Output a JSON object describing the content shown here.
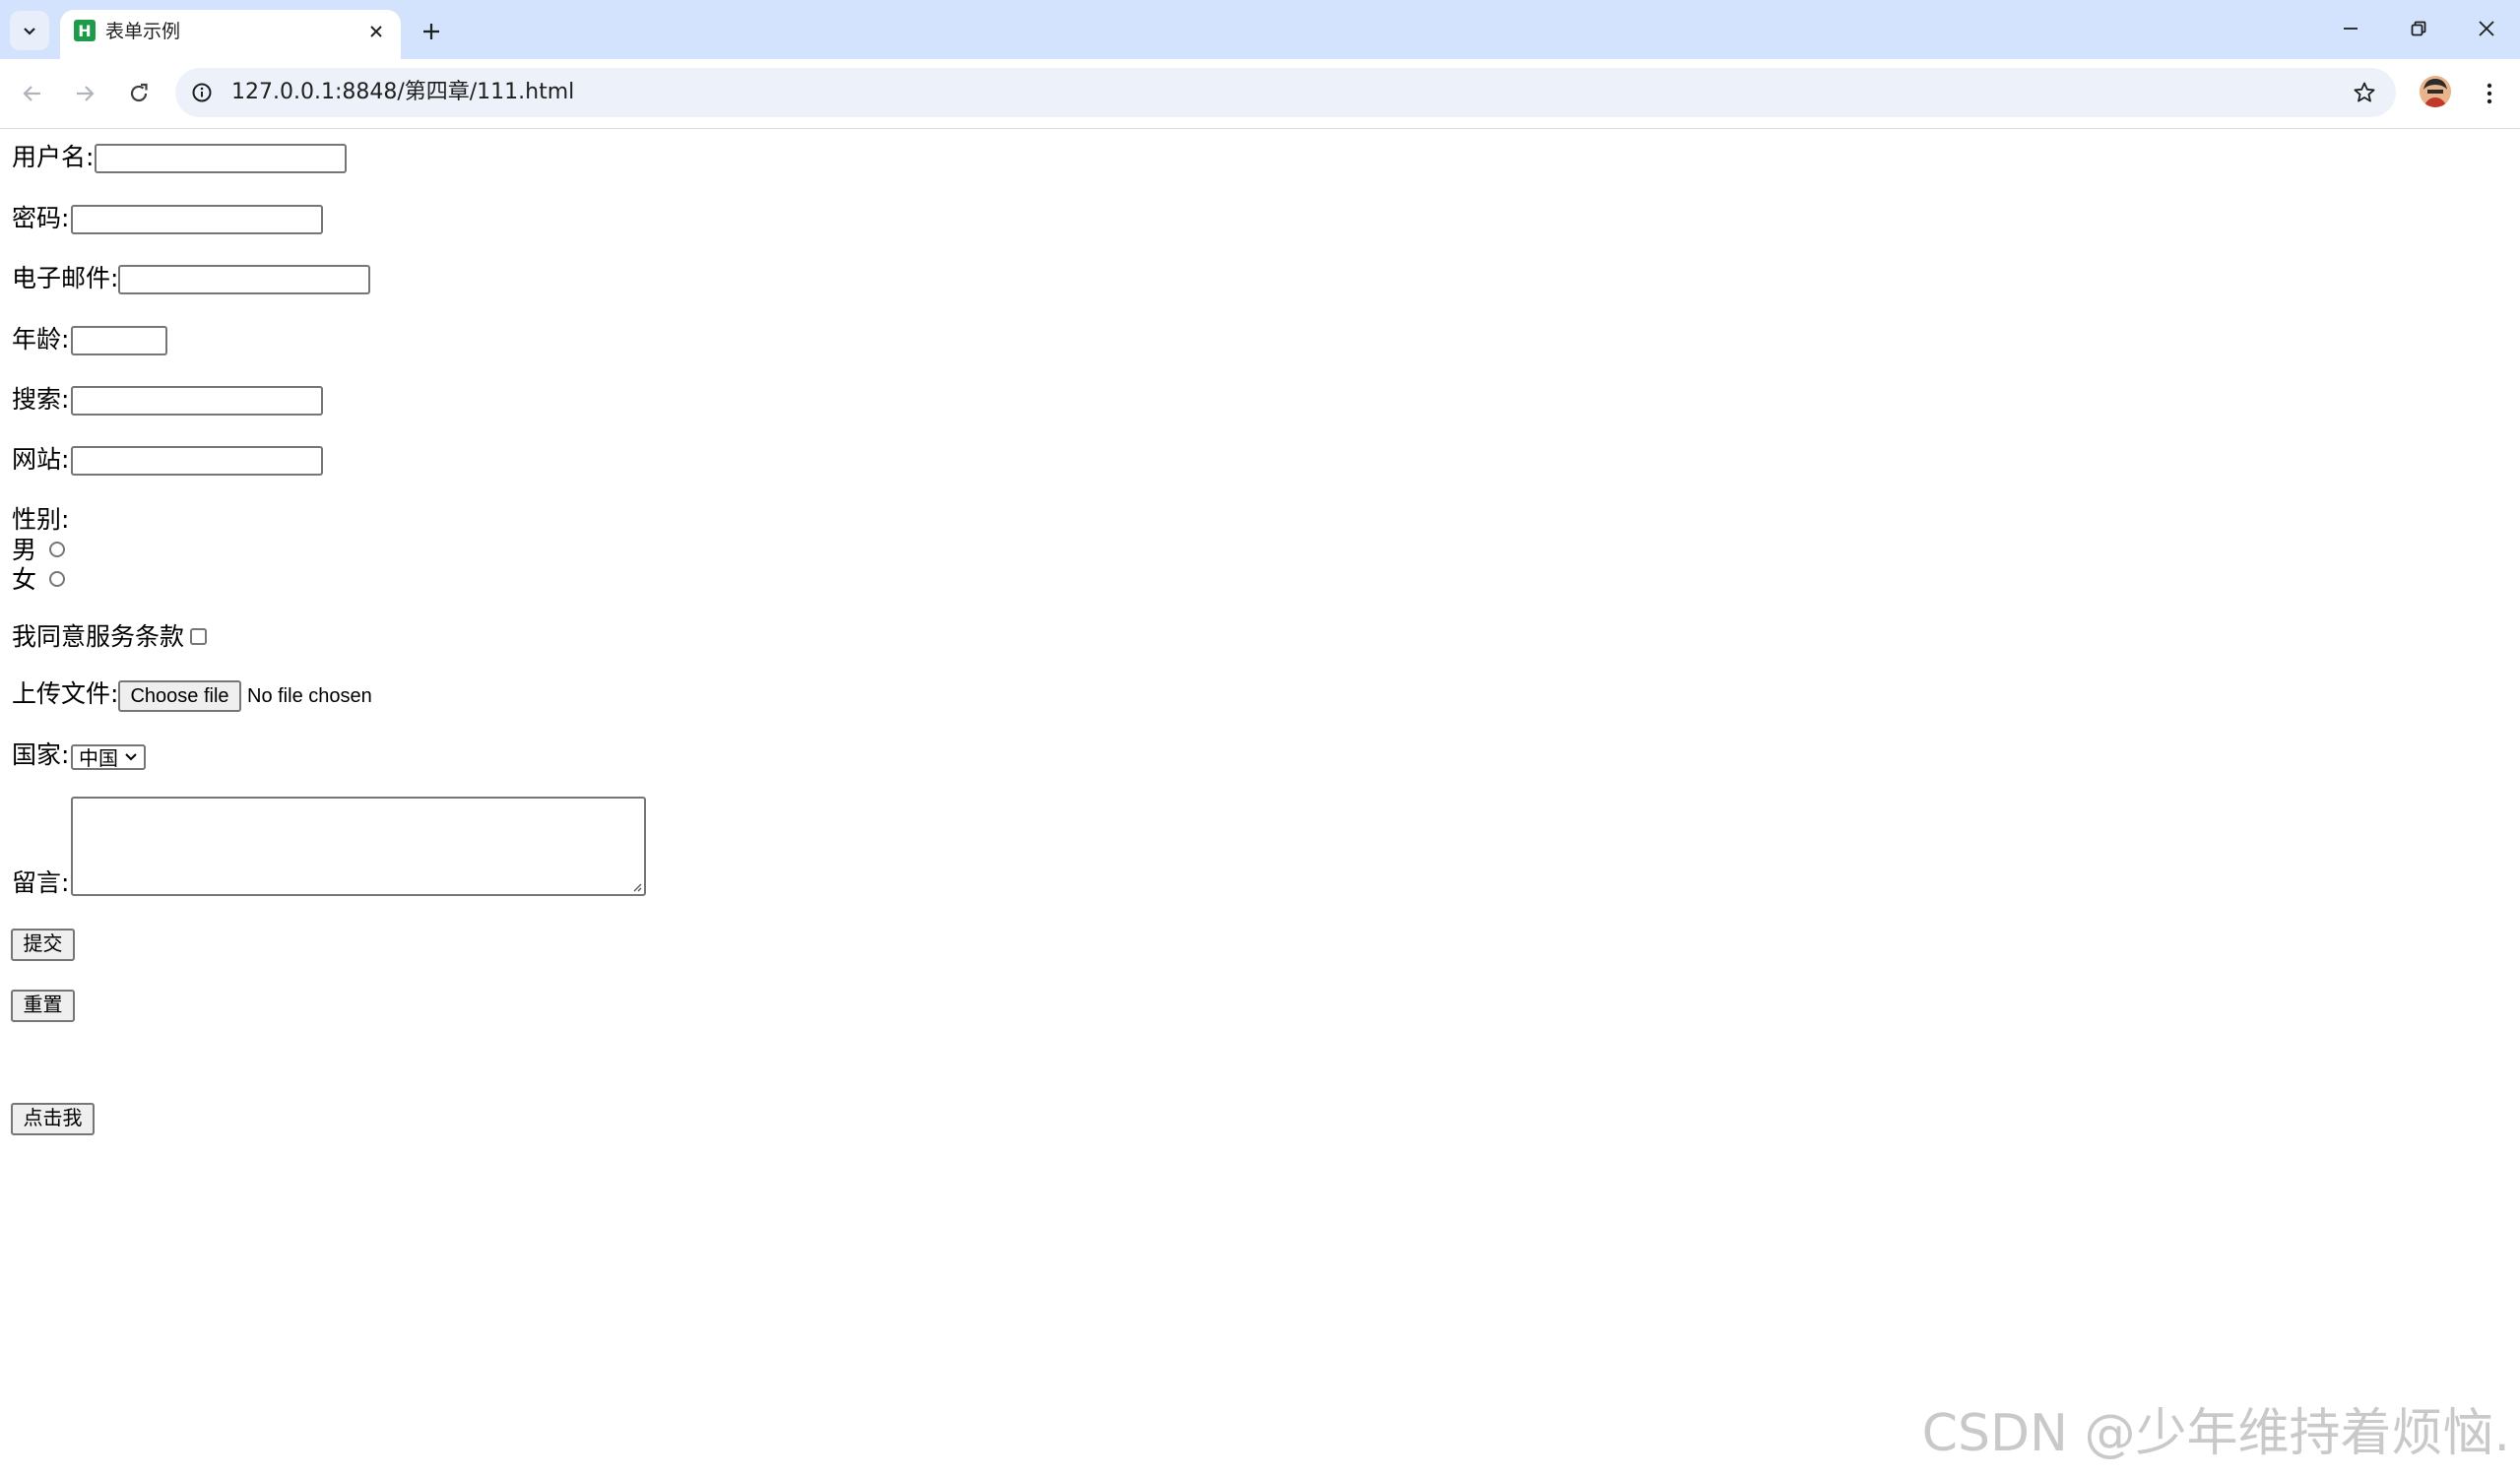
{
  "browser": {
    "tab": {
      "favicon_letter": "H",
      "title": "表单示例"
    },
    "address": {
      "url": "127.0.0.1:8848/第四章/111.html"
    }
  },
  "form": {
    "username_label": "用户名:",
    "password_label": "密码:",
    "email_label": "电子邮件:",
    "age_label": "年龄:",
    "search_label": "搜索:",
    "website_label": "网站:",
    "gender_label": "性别:",
    "gender_options": [
      "男",
      "女"
    ],
    "agree_label": "我同意服务条款",
    "upload_label": "上传文件:",
    "file_button_label": "Choose file",
    "file_status": "No file chosen",
    "country_label": "国家:",
    "country_selected": "中国",
    "message_label": "留言:",
    "submit_label": "提交",
    "reset_label": "重置",
    "click_label": "点击我"
  },
  "watermark": "CSDN @少年维持着烦恼."
}
